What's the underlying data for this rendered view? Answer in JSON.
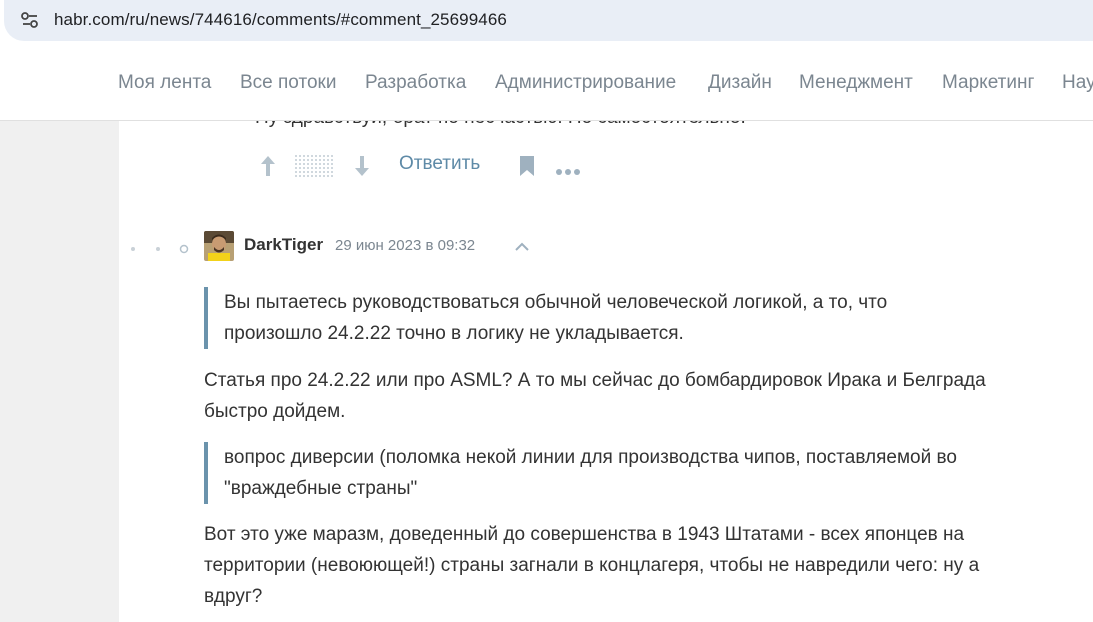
{
  "browser": {
    "url": "habr.com/ru/news/744616/comments/#comment_25699466",
    "site_info_icon": "tune-icon"
  },
  "nav": {
    "items": [
      "Моя лента",
      "Все потоки",
      "Разработка",
      "Администрирование",
      "Дизайн",
      "Менеджмент",
      "Маркетинг",
      "Нау"
    ]
  },
  "prev_comment": {
    "partial_text": "Ну здравствуй, брат по несчастью! Но самостоятельно.",
    "reply_label": "Ответить",
    "icons": [
      "arrow-up-icon",
      "arrow-down-icon",
      "bookmark-icon",
      "more-icon"
    ]
  },
  "comment": {
    "username": "DarkTiger",
    "date": "29 июн 2023 в 09:32",
    "blocks": [
      {
        "type": "quote",
        "lines": [
          "Вы пытаетесь руководствоваться обычной человеческой логикой, а то, что",
          "произошло 24.2.22 точно в логику не укладывается."
        ]
      },
      {
        "type": "para",
        "lines": [
          "Статья про 24.2.22 или про ASML? А то мы сейчас до бомбардировок Ирака и Белграда",
          "быстро дойдем."
        ]
      },
      {
        "type": "quote",
        "lines": [
          "вопрос диверсии (поломка некой линии для производства чипов, поставляемой во",
          "\"враждебные страны\""
        ]
      },
      {
        "type": "para",
        "lines": [
          "Вот это уже маразм, доведенный до совершенства в 1943 Штатами - всех японцев на",
          "территории (невоюющей!) страны загнали в концлагеря, чтобы не навредили чего: ну а",
          "вдруг?"
        ]
      }
    ]
  },
  "colors": {
    "accent": "#5e8aa7",
    "quote_border": "#6b93ac",
    "nav_text": "#7b8690",
    "body_text": "#333333"
  }
}
